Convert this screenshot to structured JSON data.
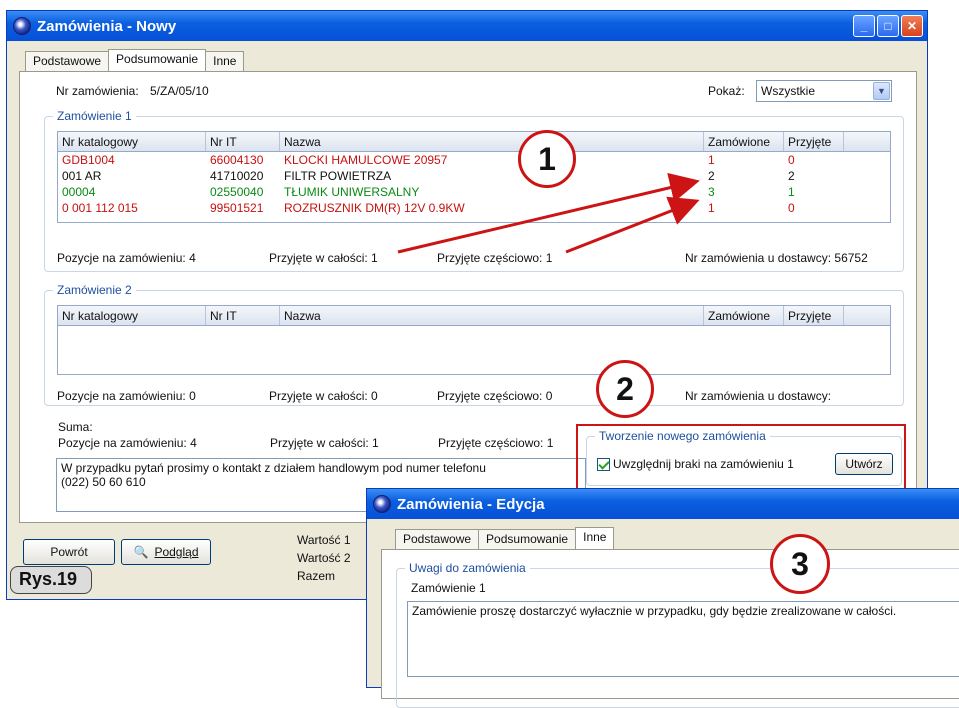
{
  "main_window": {
    "title": "Zamówienia - Nowy",
    "tabs": [
      "Podstawowe",
      "Podsumowanie",
      "Inne"
    ],
    "order_no_label": "Nr zamówienia:",
    "order_no_value": "5/ZA/05/10",
    "show_label": "Pokaż:",
    "show_value": "Wszystkie",
    "group1_title": "Zamówienie 1",
    "group2_title": "Zamówienie 2",
    "columns": [
      "Nr katalogowy",
      "Nr IT",
      "Nazwa",
      "Zamówione",
      "Przyjęte"
    ],
    "rows": [
      {
        "cat": "GDB1004",
        "it": "66004130",
        "name": "KLOCKI HAMULCOWE     20957",
        "ordered": "1",
        "received": "0",
        "color": "#c81010"
      },
      {
        "cat": "001  AR",
        "it": "41710020",
        "name": "FILTR POWIETRZA",
        "ordered": "2",
        "received": "2",
        "color": "#111111"
      },
      {
        "cat": "00004",
        "it": "02550040",
        "name": "TŁUMIK UNIWERSALNY",
        "ordered": "3",
        "received": "1",
        "color": "#0a8a14"
      },
      {
        "cat": "0 001 112 015",
        "it": "99501521",
        "name": "ROZRUSZNIK DM(R) 12V 0.9KW",
        "ordered": "1",
        "received": "0",
        "color": "#c81010"
      }
    ],
    "g1_positions": "Pozycje na zamówieniu:  4",
    "g1_full": "Przyjęte w całości: 1",
    "g1_partial": "Przyjęte częściowo: 1",
    "g1_supplier": "Nr zamówienia u dostawcy:  56752",
    "g2_positions": "Pozycje na zamówieniu:  0",
    "g2_full": "Przyjęte w całości: 0",
    "g2_partial": "Przyjęte częściowo: 0",
    "g2_supplier": "Nr zamówienia u dostawcy:",
    "sum_label": "Suma:",
    "sum_positions": "Pozycje na zamówieniu:  4",
    "sum_full": "Przyjęte w całości: 1",
    "sum_partial": "Przyjęte częściowo: 1",
    "note_line1": "W przypadku pytań prosimy o kontakt z działem handlowym pod numer telefonu",
    "note_line2": "(022) 50 60 610",
    "new_order_group_title": "Tworzenie nowego zamówienia",
    "include_missing_label": "Uwzględnij braki na zamówieniu 1",
    "create_button": "Utwórz",
    "back_button": "Powrót",
    "preview_button": "Podgląd",
    "value1_label": "Wartość 1",
    "value2_label": "Wartość 2",
    "total_label": "Razem"
  },
  "edit_window": {
    "title": "Zamówienia - Edycja",
    "tabs": [
      "Podstawowe",
      "Podsumowanie",
      "Inne"
    ],
    "notes_group_title": "Uwagi do zamówienia",
    "order_label": "Zamówienie 1",
    "note_text": "Zamówienie proszę dostarczyć wyłacznie w przypadku, gdy będzie zrealizowane w całości."
  },
  "annotations": {
    "callout_1": "1",
    "callout_2": "2",
    "callout_3": "3",
    "figure_label": "Rys.19"
  },
  "colors": {
    "accent_red": "#cc1414",
    "title_blue": "#0b5fe0"
  }
}
